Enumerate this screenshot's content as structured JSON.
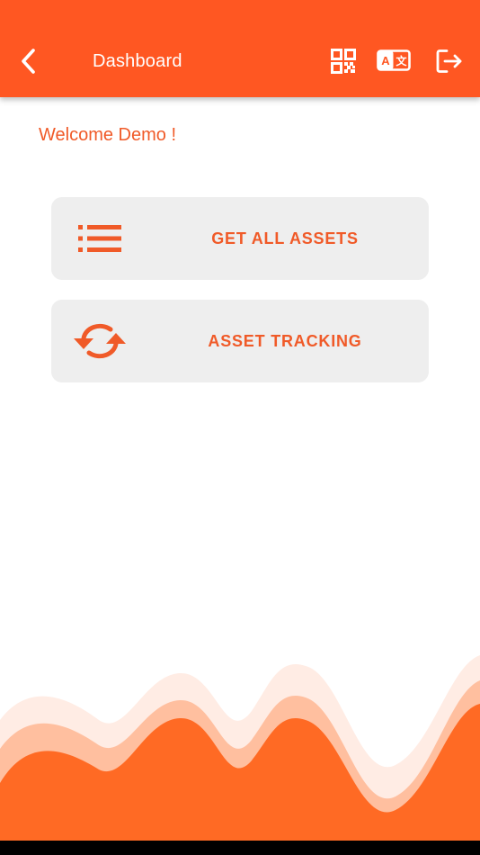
{
  "colors": {
    "primary": "#ff5722",
    "accent_text": "#f05a28",
    "card_bg": "#eeeeee",
    "wave_light": "#ffece4",
    "wave_mid": "#ffbf9f",
    "wave_dark": "#ff6a24"
  },
  "appbar": {
    "title": "Dashboard",
    "back_icon": "chevron-left-icon",
    "actions": [
      {
        "name": "qr-code-icon"
      },
      {
        "name": "translate-icon",
        "glyph_latin": "A",
        "glyph_cjk": "文"
      },
      {
        "name": "logout-icon"
      }
    ]
  },
  "welcome": {
    "text": "Welcome Demo !"
  },
  "menu": {
    "items": [
      {
        "label": "GET ALL ASSETS",
        "icon": "list-icon"
      },
      {
        "label": "ASSET TRACKING",
        "icon": "sync-icon"
      }
    ]
  }
}
